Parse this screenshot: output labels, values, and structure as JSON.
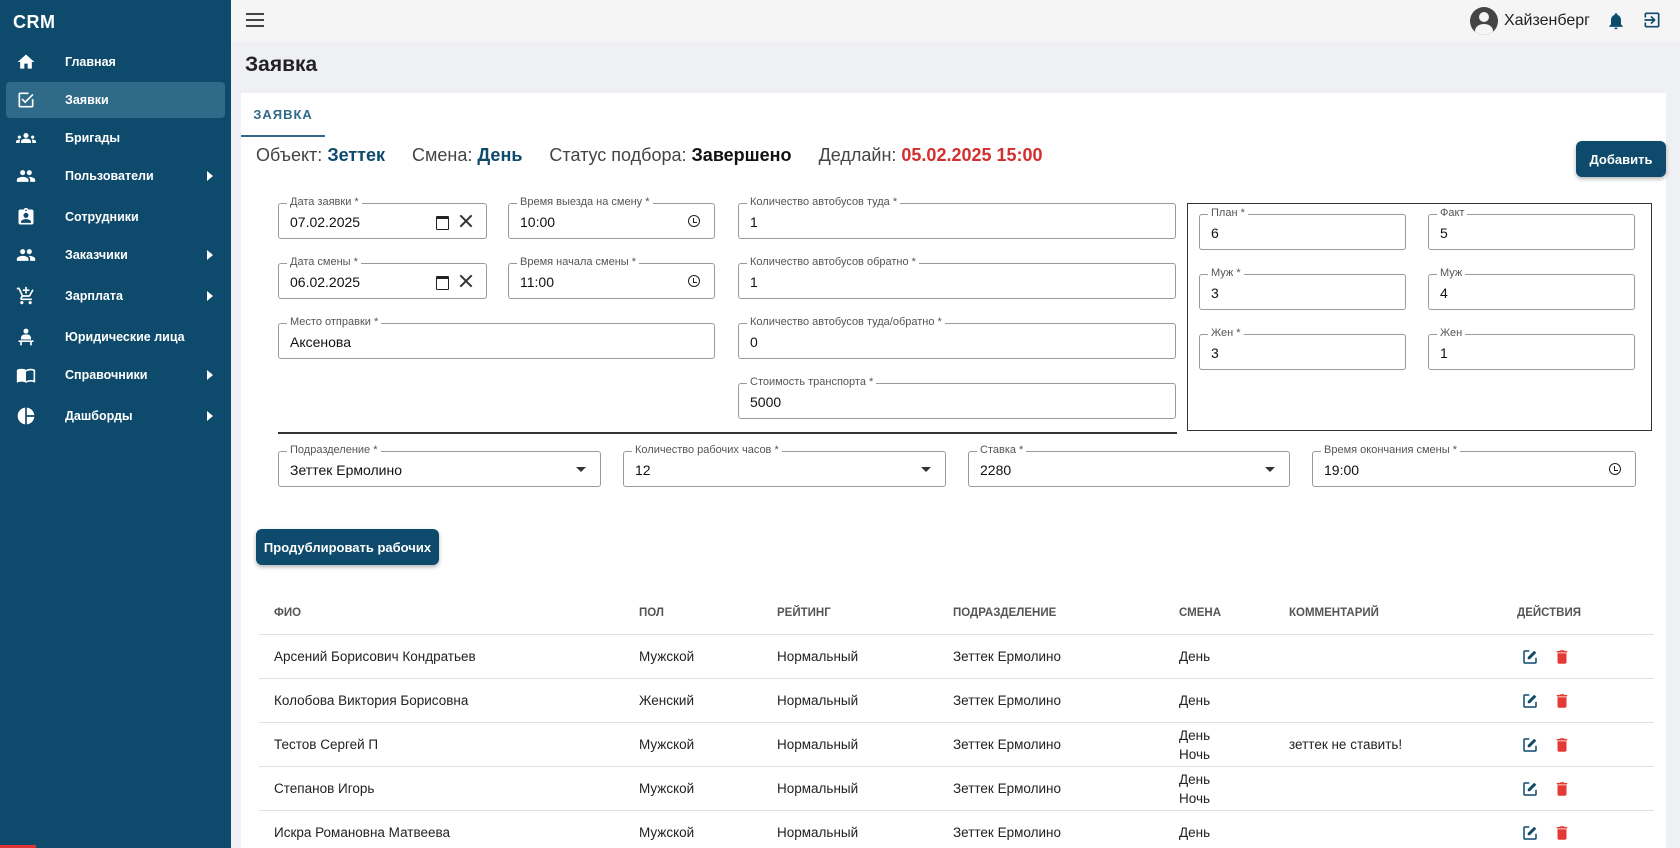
{
  "sidebar": {
    "brand": "CRM",
    "items": [
      {
        "label": "Главная",
        "icon": "home-icon",
        "has_children": false,
        "active": false
      },
      {
        "label": "Заявки",
        "icon": "checkbox-icon",
        "has_children": false,
        "active": true
      },
      {
        "label": "Бригады",
        "icon": "group-icon",
        "has_children": false,
        "active": false
      },
      {
        "label": "Пользователи",
        "icon": "users-icon",
        "has_children": true,
        "active": false
      },
      {
        "label": "Сотрудники",
        "icon": "clipboard-user-icon",
        "has_children": false,
        "active": false
      },
      {
        "label": "Заказчики",
        "icon": "customers-icon",
        "has_children": true,
        "active": false
      },
      {
        "label": "Зарплата",
        "icon": "cart-icon",
        "has_children": true,
        "active": false
      },
      {
        "label": "Юридические лица",
        "icon": "person-desk-icon",
        "has_children": false,
        "active": false
      },
      {
        "label": "Справочники",
        "icon": "book-icon",
        "has_children": true,
        "active": false
      },
      {
        "label": "Дашборды",
        "icon": "pie-chart-icon",
        "has_children": true,
        "active": false
      }
    ]
  },
  "topbar": {
    "username": "Хайзенберг"
  },
  "page": {
    "title": "Заявка",
    "tab": "ЗАЯВКА"
  },
  "info": {
    "object_label": "Объект:",
    "object_value": "Зеттек",
    "shift_label": "Смена:",
    "shift_value": "День",
    "status_label": "Статус подбора:",
    "status_value": "Завершено",
    "deadline_label": "Дедлайн:",
    "deadline_value": "05.02.2025 15:00"
  },
  "buttons": {
    "add": "Добавить",
    "duplicate": "Продублировать рабочих"
  },
  "form": {
    "request_date": {
      "label": "Дата заявки *",
      "value": "07.02.2025"
    },
    "departure_time": {
      "label": "Время выезда на смену *",
      "value": "10:00"
    },
    "buses_there": {
      "label": "Количество автобусов туда *",
      "value": "1"
    },
    "shift_date": {
      "label": "Дата смены *",
      "value": "06.02.2025"
    },
    "shift_start": {
      "label": "Время начала смены *",
      "value": "11:00"
    },
    "buses_back": {
      "label": "Количество автобусов обратно *",
      "value": "1"
    },
    "departure_place": {
      "label": "Место отправки *",
      "value": "Аксенова"
    },
    "buses_both": {
      "label": "Количество автобусов туда/обратно *",
      "value": "0"
    },
    "transport_cost": {
      "label": "Стоимость транспорта *",
      "value": "5000"
    },
    "division": {
      "label": "Подразделение *",
      "value": "Зеттек Ермолино"
    },
    "work_hours": {
      "label": "Количество рабочих часов *",
      "value": "12"
    },
    "rate": {
      "label": "Ставка *",
      "value": "2280"
    },
    "shift_end": {
      "label": "Время окончания смены *",
      "value": "19:00"
    }
  },
  "counts": {
    "plan": {
      "label": "План *",
      "value": "6"
    },
    "fact": {
      "label": "Факт",
      "value": "5"
    },
    "male_plan": {
      "label": "Муж *",
      "value": "3"
    },
    "male_fact": {
      "label": "Муж",
      "value": "4"
    },
    "female_plan": {
      "label": "Жен *",
      "value": "3"
    },
    "female_fact": {
      "label": "Жен",
      "value": "1"
    }
  },
  "table": {
    "headers": [
      "ФИО",
      "ПОЛ",
      "РЕЙТИНГ",
      "ПОДРАЗДЕЛЕНИЕ",
      "СМЕНА",
      "КОММЕНТАРИЙ",
      "ДЕЙСТВИЯ"
    ],
    "rows": [
      {
        "name": "Арсений Борисович Кондратьев",
        "gender": "Мужской",
        "rating": "Нормальный",
        "division": "Зеттек Ермолино",
        "shift": [
          "День"
        ],
        "comment": ""
      },
      {
        "name": "Колобова Виктория Борисовна",
        "gender": "Женский",
        "rating": "Нормальный",
        "division": "Зеттек Ермолино",
        "shift": [
          "День"
        ],
        "comment": ""
      },
      {
        "name": "Тестов Сергей П",
        "gender": "Мужской",
        "rating": "Нормальный",
        "division": "Зеттек Ермолино",
        "shift": [
          "День",
          "Ночь"
        ],
        "comment": "зеттек не ставить!"
      },
      {
        "name": "Степанов Игорь",
        "gender": "Мужской",
        "rating": "Нормальный",
        "division": "Зеттек Ермолино",
        "shift": [
          "День",
          "Ночь"
        ],
        "comment": ""
      },
      {
        "name": "Искра Романовна Матвеева",
        "gender": "Мужской",
        "rating": "Нормальный",
        "division": "Зеттек Ермолино",
        "shift": [
          "День"
        ],
        "comment": ""
      }
    ]
  },
  "colors": {
    "sidebar_bg": "#0d4a6b",
    "sidebar_active": "#2f6a89",
    "accent": "#0d4a6b",
    "deadline": "#d32f2f",
    "delete": "#e53935"
  }
}
